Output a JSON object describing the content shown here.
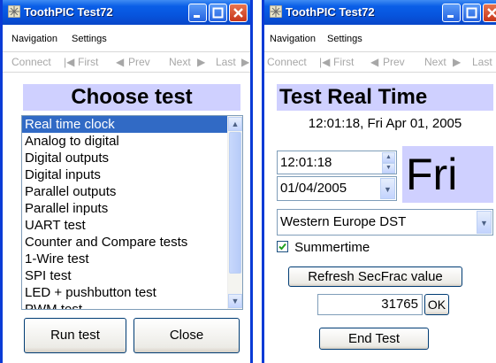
{
  "windows": [
    {
      "title": "ToothPIC Test72",
      "menu": {
        "navigation": "Navigation",
        "settings": "Settings"
      },
      "toolbar": {
        "connect": "Connect",
        "first": "First",
        "prev": "Prev",
        "next": "Next",
        "last": "Last"
      },
      "heading": "Choose test",
      "tests": [
        "Real time clock",
        "Analog to digital",
        "Digital outputs",
        "Digital inputs",
        "Parallel outputs",
        "Parallel inputs",
        "UART test",
        "Counter and Compare tests",
        "1-Wire test",
        "SPI test",
        "LED + pushbutton test",
        "PWM test"
      ],
      "selected_index": 0,
      "run_button": "Run test",
      "close_button": "Close"
    },
    {
      "title": "ToothPIC Test72",
      "menu": {
        "navigation": "Navigation",
        "settings": "Settings"
      },
      "toolbar": {
        "connect": "Connect",
        "first": "First",
        "prev": "Prev",
        "next": "Next",
        "last": "Last"
      },
      "heading": "Test Real Time",
      "datetime": "12:01:18, Fri Apr 01, 2005",
      "time_value": "12:01:18",
      "date_value": "01/04/2005",
      "day": "Fri",
      "timezone": "Western Europe DST",
      "summertime_label": "Summertime",
      "summertime_checked": true,
      "refresh_button": "Refresh SecFrac value",
      "secfrac_value": "31765",
      "ok_button": "OK",
      "end_button": "End Test"
    }
  ],
  "colors": {
    "titlebar": "#0a5fe7",
    "heading_bg": "#cfd0ff",
    "selection": "#316ac5"
  }
}
